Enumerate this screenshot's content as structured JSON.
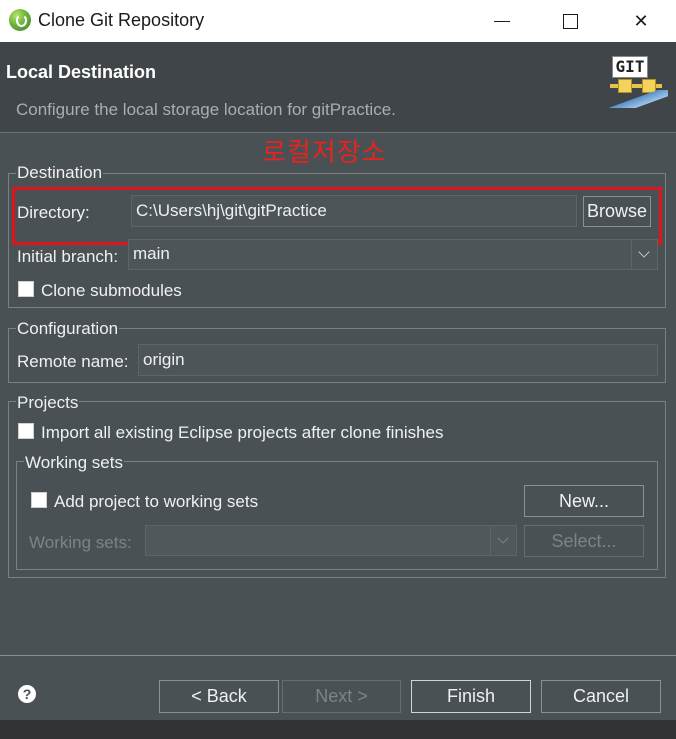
{
  "window": {
    "title": "Clone Git Repository",
    "close_glyph": "✕"
  },
  "header": {
    "heading": "Local Destination",
    "description": "Configure the local storage location for gitPractice.",
    "logo_text": "GIT"
  },
  "annotation": {
    "text": "로컬저장소",
    "color": "#e8231f"
  },
  "destination": {
    "legend": "Destination",
    "directory_label": "Directory:",
    "directory_value": "C:\\Users\\hj\\git\\gitPractice",
    "browse_label": "Browse",
    "initial_branch_label": "Initial branch:",
    "initial_branch_value": "main",
    "clone_submodules_label": "Clone submodules",
    "clone_submodules_checked": false
  },
  "configuration": {
    "legend": "Configuration",
    "remote_name_label": "Remote name:",
    "remote_name_value": "origin"
  },
  "projects": {
    "legend": "Projects",
    "import_label": "Import all existing Eclipse projects after clone finishes",
    "import_checked": false,
    "working_sets": {
      "legend": "Working sets",
      "add_label": "Add project to working sets",
      "add_checked": false,
      "new_label": "New...",
      "working_sets_label": "Working sets:",
      "working_sets_value": "",
      "select_label": "Select..."
    }
  },
  "footer": {
    "help_glyph": "?",
    "back_label": "< Back",
    "next_label": "Next >",
    "finish_label": "Finish",
    "cancel_label": "Cancel"
  }
}
